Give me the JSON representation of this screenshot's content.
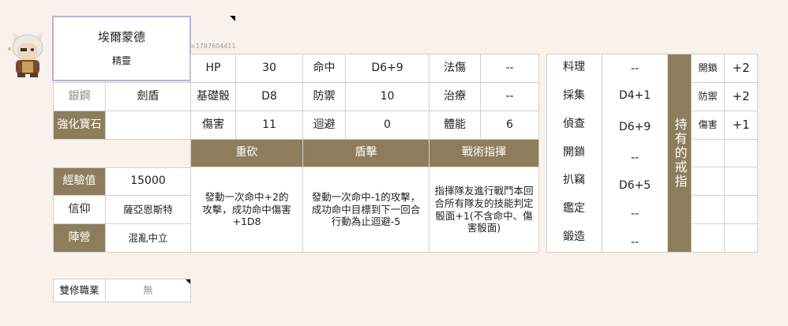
{
  "character": {
    "name": "埃爾蒙德",
    "race": "精靈",
    "id": "=1787604411"
  },
  "rank": {
    "label": "銀鋼",
    "value": "劍盾"
  },
  "gem": {
    "label": "強化寶石",
    "value": ""
  },
  "info": {
    "exp_label": "經驗值",
    "exp_value": "15000",
    "faith_label": "信仰",
    "faith_value": "薩亞恩斯特",
    "camp_label": "陣營",
    "camp_value": "混亂中立"
  },
  "dual": {
    "label": "雙修職業",
    "value": "無"
  },
  "stats": {
    "hp_label": "HP",
    "hp_value": "30",
    "hit_label": "命中",
    "hit_value": "D6+9",
    "mdmg_label": "法傷",
    "mdmg_value": "--",
    "base_label": "基礎骰",
    "base_value": "D8",
    "def_label": "防禦",
    "def_value": "10",
    "heal_label": "治療",
    "heal_value": "--",
    "dmg_label": "傷害",
    "dmg_value": "11",
    "eva_label": "迴避",
    "eva_value": "0",
    "stam_label": "體能",
    "stam_value": "6"
  },
  "skills": [
    {
      "name": "重砍",
      "desc": "發動一次命中+2的攻擊，成功命中傷害+1D8"
    },
    {
      "name": "盾擊",
      "desc": "發動一次命中-1的攻擊，成功命中目標到下一回合行動為止迴避-5"
    },
    {
      "name": "戰術指揮",
      "desc": "指揮隊友進行戰鬥本回合所有隊友的技能判定骰面+1(不含命中、傷害骰面)"
    }
  ],
  "lifeskills": [
    {
      "label": "料理",
      "value": "--"
    },
    {
      "label": "採集",
      "value": "D4+1"
    },
    {
      "label": "偵查",
      "value": "D6+9"
    },
    {
      "label": "開鎖",
      "value": "--"
    },
    {
      "label": "扒竊",
      "value": "D6+5"
    },
    {
      "label": "鑑定",
      "value": "--"
    },
    {
      "label": "鍛造",
      "value": "--"
    }
  ],
  "rings": {
    "title": "持有的戒指",
    "items": [
      {
        "label": "開鎖",
        "value": "+2"
      },
      {
        "label": "防禦",
        "value": "+2"
      },
      {
        "label": "傷害",
        "value": "+1"
      }
    ]
  },
  "colors": {
    "accent": "#8d7d5d",
    "bg": "#f8f1ec"
  }
}
